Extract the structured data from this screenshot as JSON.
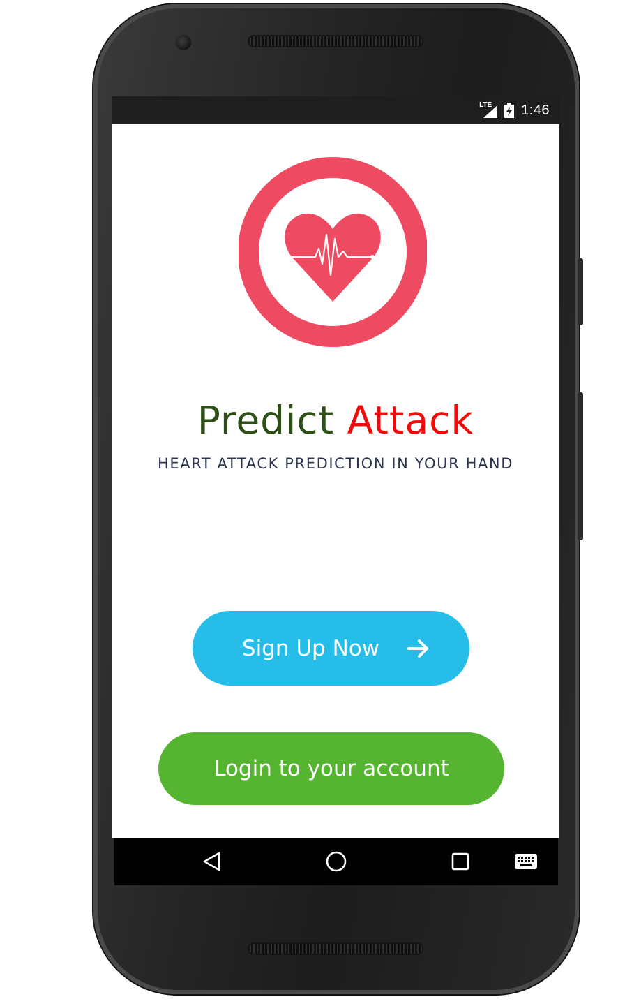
{
  "status_bar": {
    "network": "LTE",
    "time": "1:46"
  },
  "app": {
    "title_word1": "Predict",
    "title_word2": "Attack",
    "tagline": "HEART ATTACK PREDICTION IN YOUR HAND",
    "colors": {
      "logo": "#ee4a62",
      "title_word1": "#2f4f19",
      "title_word2": "#f20a0a",
      "tagline": "#2a3650",
      "signup_button": "#26bde8",
      "login_button": "#55b430"
    }
  },
  "actions": {
    "signup_label": "Sign Up Now",
    "signup_icon": "arrow-right-icon",
    "login_label": "Login to your account"
  },
  "nav_bar": {
    "items": [
      "back-icon",
      "home-icon",
      "recents-icon",
      "keyboard-icon"
    ]
  }
}
